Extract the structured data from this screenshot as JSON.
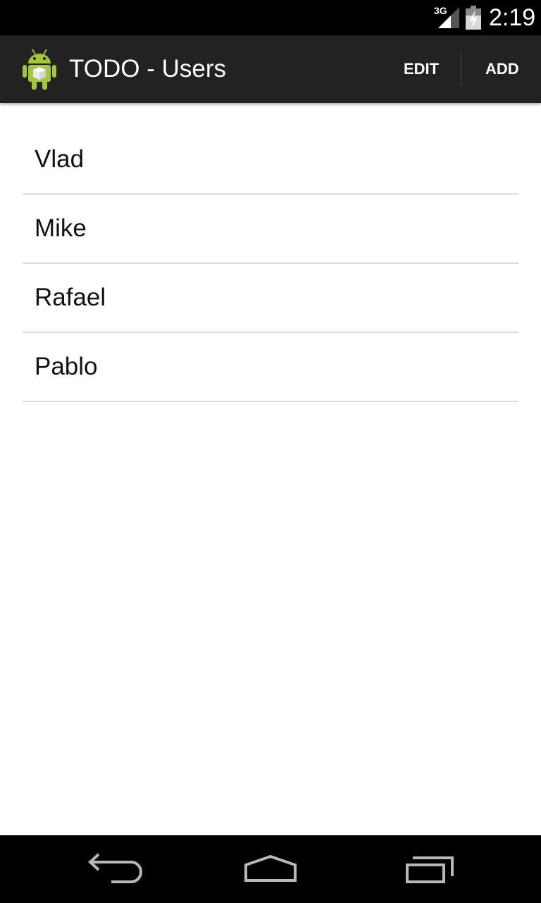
{
  "status_bar": {
    "network": "3G",
    "time": "2:19",
    "icons": [
      "signal-icon",
      "battery-icon"
    ]
  },
  "action_bar": {
    "app_icon": "android-robot-icon",
    "title": "TODO - Users",
    "edit_label": "EDIT",
    "add_label": "ADD"
  },
  "users": [
    {
      "name": "Vlad"
    },
    {
      "name": "Mike"
    },
    {
      "name": "Rafael"
    },
    {
      "name": "Pablo"
    }
  ],
  "nav_bar": {
    "icons": [
      "back-icon",
      "home-icon",
      "recent-apps-icon"
    ]
  }
}
